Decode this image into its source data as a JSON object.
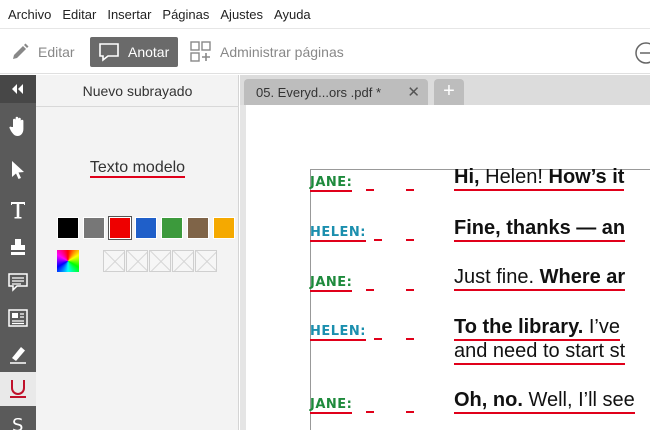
{
  "menu": {
    "items": [
      "Archivo",
      "Editar",
      "Insertar",
      "Páginas",
      "Ajustes",
      "Ayuda"
    ]
  },
  "toolbar": {
    "edit_label": "Editar",
    "annotate_label": "Anotar",
    "manage_pages_label": "Administrar páginas"
  },
  "panel": {
    "title": "Nuevo subrayado",
    "sample_text": "Texto modelo",
    "colors": [
      "#000000",
      "#777777",
      "#ee0000",
      "#1f5fc9",
      "#3c9a3c",
      "#7f6448",
      "#f5a900"
    ],
    "selected_color": "#ee0000"
  },
  "tabs": {
    "active_label": "05. Everyd...ors .pdf *",
    "close_symbol": "✕",
    "add_symbol": "+"
  },
  "document": {
    "lines": [
      {
        "speaker": "JANE:",
        "segments": [
          {
            "t": "Hi,",
            "b": true
          },
          {
            "t": " Helen! ",
            "b": false
          },
          {
            "t": "How’s it",
            "b": true
          }
        ]
      },
      {
        "speaker": "HELEN:",
        "segments": [
          {
            "t": "Fine, thanks — an",
            "b": true
          }
        ]
      },
      {
        "speaker": "JANE:",
        "segments": [
          {
            "t": "Just fine. ",
            "b": false
          },
          {
            "t": "Where ar",
            "b": true
          }
        ]
      },
      {
        "speaker": "HELEN:",
        "segments": [
          {
            "t": "To the library.",
            "b": true
          },
          {
            "t": " I’ve",
            "b": false
          }
        ],
        "continuation": "and need to start st"
      },
      {
        "speaker": "JANE:",
        "segments": [
          {
            "t": "Oh, no.",
            "b": true
          },
          {
            "t": " Well, I’ll see",
            "b": false
          }
        ]
      }
    ]
  }
}
